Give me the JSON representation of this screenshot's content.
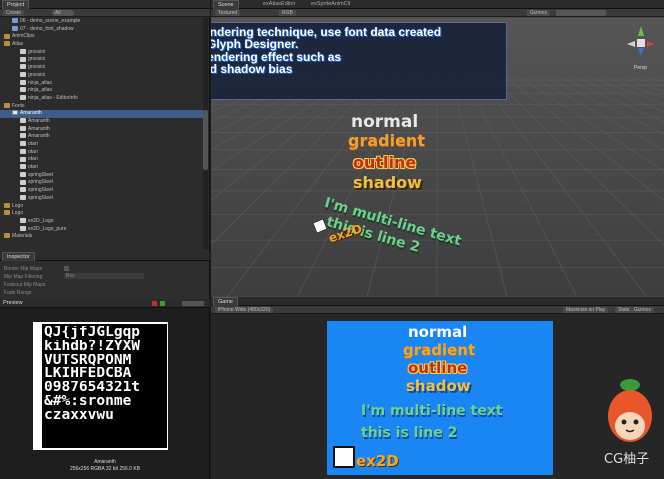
{
  "project": {
    "tab": "Project",
    "create_label": "Create",
    "search_label": "All",
    "tree": [
      {
        "label": "06 - demo_scene_example",
        "kind": "scene",
        "indent": 1
      },
      {
        "label": "07 - demo_font_shadow",
        "kind": "scene",
        "indent": 1
      },
      {
        "label": "AnimClips",
        "kind": "folder",
        "indent": 0
      },
      {
        "label": "Atlas",
        "kind": "folder",
        "indent": 0
      },
      {
        "label": "grossini",
        "kind": "file",
        "indent": 2
      },
      {
        "label": "grossini",
        "kind": "file",
        "indent": 2
      },
      {
        "label": "grossini",
        "kind": "file",
        "indent": 2
      },
      {
        "label": "grossini",
        "kind": "file",
        "indent": 2
      },
      {
        "label": "ninja_atlas",
        "kind": "file",
        "indent": 2
      },
      {
        "label": "ninja_atlas",
        "kind": "file",
        "indent": 2
      },
      {
        "label": "ninja_atlas - EditorInfo",
        "kind": "file",
        "indent": 2
      },
      {
        "label": "Fonts",
        "kind": "folder",
        "indent": 0
      },
      {
        "label": "Amaranth",
        "kind": "font",
        "indent": 1,
        "selected": true
      },
      {
        "label": "Amaranth",
        "kind": "file",
        "indent": 2
      },
      {
        "label": "Amaranth",
        "kind": "file",
        "indent": 2
      },
      {
        "label": "Amaranth",
        "kind": "file",
        "indent": 2
      },
      {
        "label": "otari",
        "kind": "file",
        "indent": 2
      },
      {
        "label": "otari",
        "kind": "file",
        "indent": 2
      },
      {
        "label": "otari",
        "kind": "file",
        "indent": 2
      },
      {
        "label": "otari",
        "kind": "file",
        "indent": 2
      },
      {
        "label": "springSteel",
        "kind": "file",
        "indent": 2
      },
      {
        "label": "springSteel",
        "kind": "file",
        "indent": 2
      },
      {
        "label": "springSteel",
        "kind": "file",
        "indent": 2
      },
      {
        "label": "springSteel",
        "kind": "file",
        "indent": 2
      },
      {
        "label": "Logo",
        "kind": "folder",
        "indent": 0
      },
      {
        "label": "Logo",
        "kind": "folder",
        "indent": 0
      },
      {
        "label": "ex2D_Logo",
        "kind": "file",
        "indent": 2
      },
      {
        "label": "ex2D_Logo_pure",
        "kind": "file",
        "indent": 2
      },
      {
        "label": "Materials",
        "kind": "folder",
        "indent": 0
      }
    ]
  },
  "inspector": {
    "tab": "Inspector",
    "rows": [
      "Border Mip Maps",
      "Mip Map Filtering",
      "Fadeout Mip Maps",
      "Fade Range"
    ],
    "filter_value": "Box"
  },
  "preview": {
    "title": "Preview",
    "glyph_lines": [
      "QJ{jfJGLgqp",
      "kihdb?!ZYXW",
      "VUTSRQPONM",
      "LKIHFEDCBA",
      "0987654321t",
      "&#%:sronme",
      "czaxxvwu"
    ],
    "asset_name": "Amaranth",
    "asset_info": "256x256  RGBA 32 bit  256.0 KB"
  },
  "scene": {
    "tabs": [
      "Scene",
      "exAtlasEditor",
      "exSpriteAnimCli"
    ],
    "toolbar": {
      "mode": "Textured",
      "color": "RGB",
      "gizmos": "Gizmos"
    },
    "persp_label": "Persp",
    "banner_lines": [
      "Powerful Bitmap Font Rendering technique, use font data created",
      "from Hiero, BMFont and Glyph Designer.",
      "Provide dynamical font rendering effect such as",
      "gradient color, outline and shadow bias"
    ],
    "words": {
      "normal": "normal",
      "gradient": "gradient",
      "outline": "outline",
      "shadow": "shadow",
      "multi1": "I'm multi-line text",
      "multi2": "this is line 2",
      "logo": "ex2D"
    }
  },
  "game": {
    "tab": "Game",
    "resolution": "iPhone Wide (480x320)",
    "maximize": "Maximize on Play",
    "stats": "Stats",
    "gizmos": "Gizmos"
  },
  "watermark": {
    "text": "CG柚子"
  },
  "colors": {
    "game_bg": "#1a86f5",
    "gradient_top": "#f5a623",
    "outline_fill": "#c8281e",
    "shadow_fill": "#f0c040",
    "multiline": "#6cd18a"
  }
}
